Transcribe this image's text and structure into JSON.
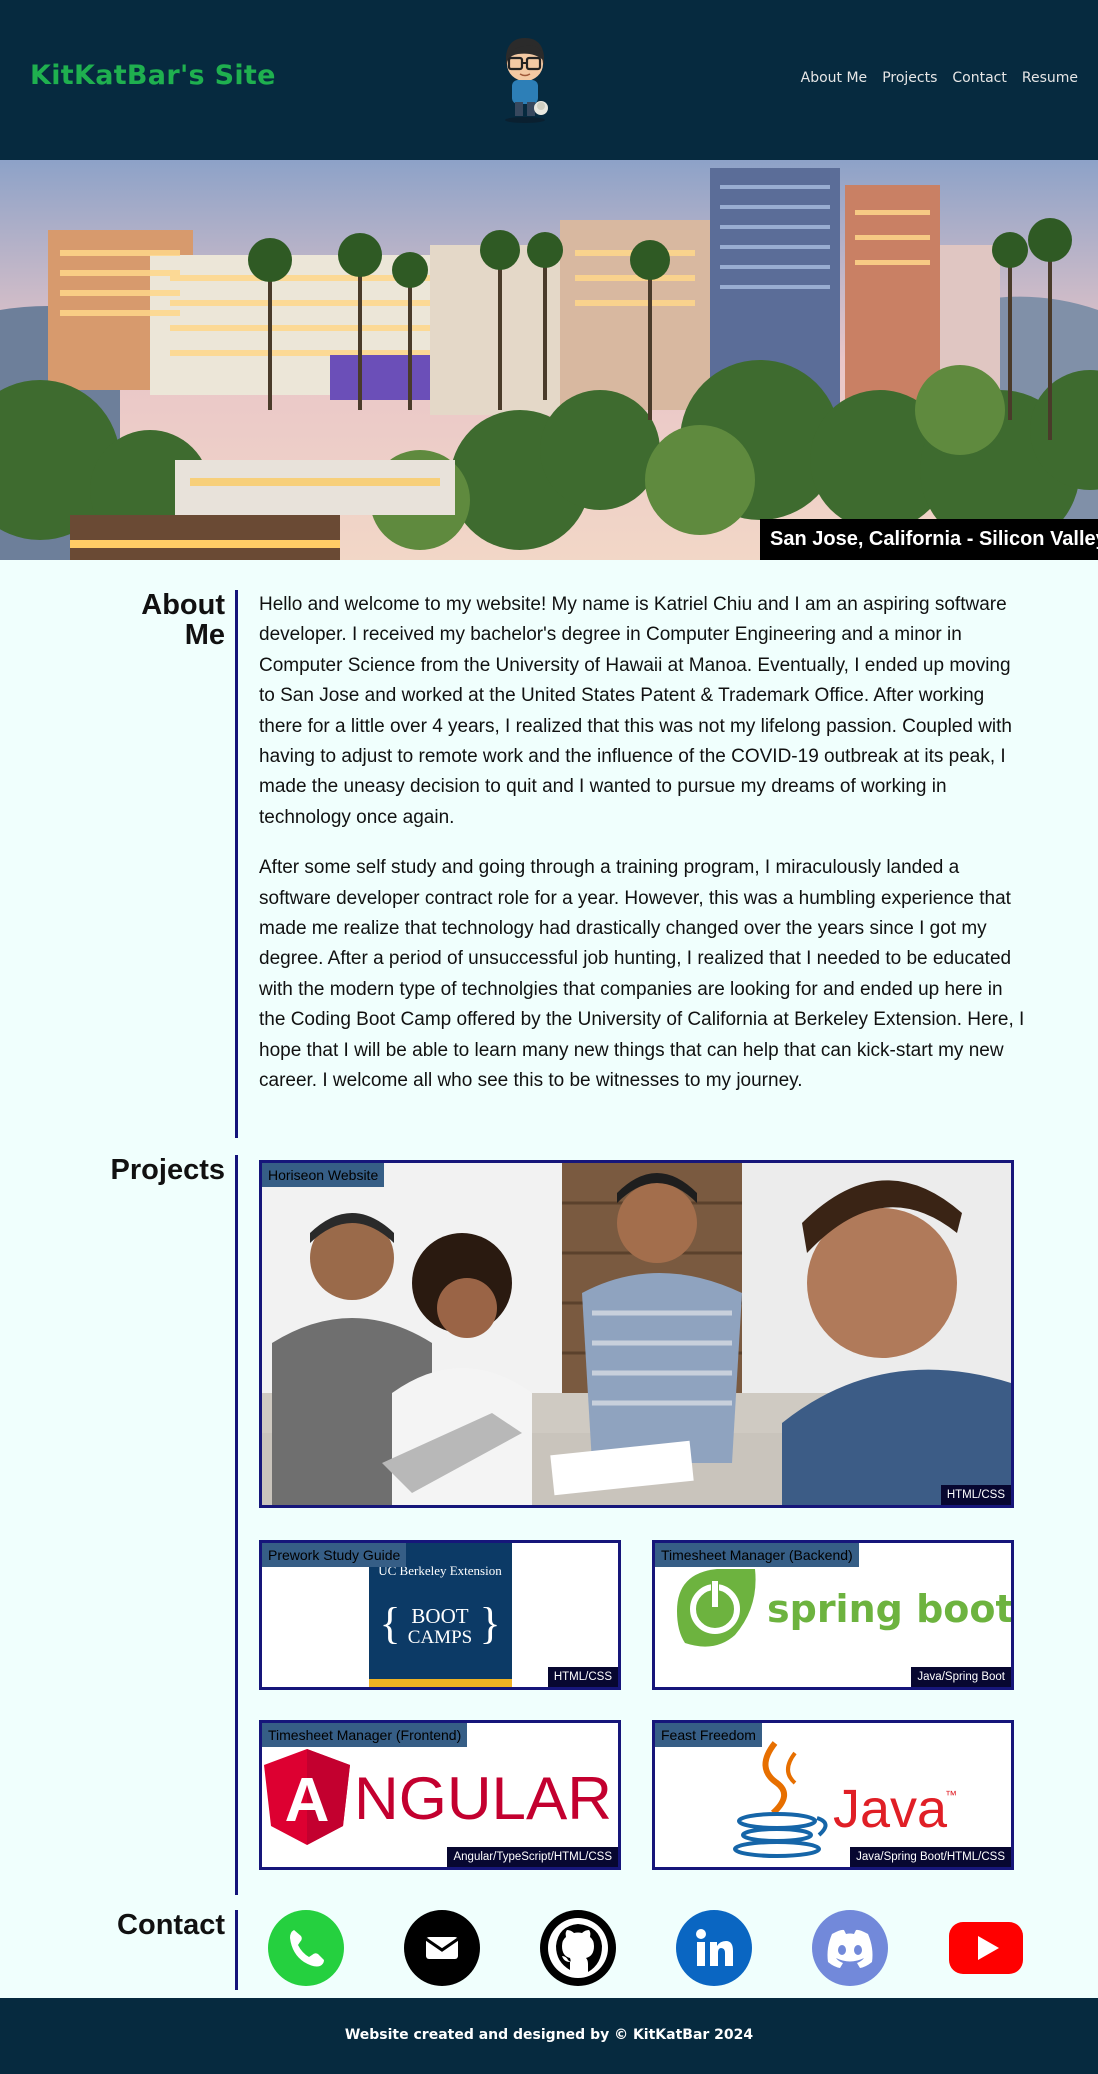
{
  "header": {
    "site_title": "KitKatBar's Site",
    "nav": [
      "About Me",
      "Projects",
      "Contact",
      "Resume"
    ]
  },
  "hero": {
    "caption": "San Jose, California - Silicon Valley"
  },
  "about": {
    "title_line1": "About",
    "title_line2": "Me",
    "paragraphs": [
      "Hello and welcome to my website! My name is Katriel Chiu and I am an aspiring software developer. I received my bachelor's degree in Computer Engineering and a minor in Computer Science from the University of Hawaii at Manoa. Eventually, I ended up moving to San Jose and worked at the United States Patent & Trademark Office. After working there for a little over 4 years, I realized that this was not my lifelong passion. Coupled with having to adjust to remote work and the influence of the COVID-19 outbreak at its peak, I made the uneasy decision to quit and I wanted to pursue my dreams of working in technology once again.",
      "After some self study and going through a training program, I miraculously landed a software developer contract role for a year. However, this was a humbling experience that made me realize that technology had drastically changed over the years since I got my degree. After a period of unsuccessful job hunting, I realized that I needed to be educated with the modern type of technolgies that companies are looking for and ended up here in the Coding Boot Camp offered by the University of California at Berkeley Extension. Here, I hope that I will be able to learn many new things that can help that can kick-start my new career. I welcome all who see this to be witnesses to my journey."
    ]
  },
  "projects": {
    "title": "Projects",
    "items": [
      {
        "name": "Horiseon Website",
        "tech": "HTML/CSS"
      },
      {
        "name": "Prework Study Guide",
        "tech": "HTML/CSS",
        "logo_line1": "UC Berkeley Extension",
        "logo_line2": "BOOT",
        "logo_line3": "CAMPS"
      },
      {
        "name": "Timesheet Manager (Backend)",
        "tech": "Java/Spring Boot",
        "logo_text": "spring boot"
      },
      {
        "name": "Timesheet Manager (Frontend)",
        "tech": "Angular/TypeScript/HTML/CSS",
        "logo_text": "NGULAR",
        "logo_letter": "A"
      },
      {
        "name": "Feast Freedom",
        "tech": "Java/Spring Boot/HTML/CSS",
        "logo_text": "Java",
        "logo_tm": "™"
      }
    ]
  },
  "contact": {
    "title": "Contact",
    "icons": [
      "phone-icon",
      "email-icon",
      "github-icon",
      "linkedin-icon",
      "discord-icon",
      "youtube-icon"
    ]
  },
  "footer": {
    "text": "Website created and designed by © KitKatBar 2024"
  },
  "colors": {
    "header_bg": "#062a3f",
    "page_bg": "#f0fffd",
    "accent_green": "#1fb04f",
    "border_navy": "#16167a"
  }
}
